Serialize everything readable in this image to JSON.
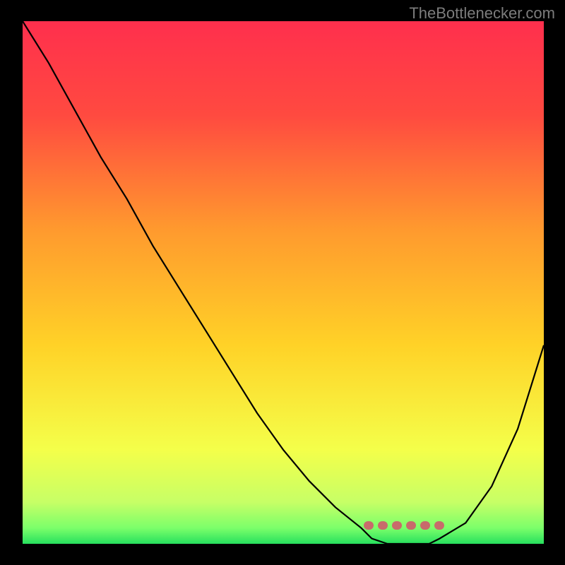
{
  "source_label": "TheBottlenecker.com",
  "colors": {
    "gradient_top": "#ff2f4d",
    "gradient_mid": "#ffd227",
    "gradient_low": "#eaff6f",
    "gradient_bottom": "#27e05e",
    "curve": "#000000",
    "dash": "#c86b6b",
    "bg": "#000000"
  },
  "chart_data": {
    "type": "line",
    "title": "",
    "xlabel": "",
    "ylabel": "",
    "xlim": [
      0,
      100
    ],
    "ylim": [
      0,
      100
    ],
    "x": [
      0,
      5,
      10,
      15,
      20,
      25,
      30,
      35,
      40,
      45,
      50,
      55,
      60,
      65,
      67,
      70,
      73,
      75,
      78,
      80,
      85,
      90,
      95,
      100
    ],
    "values": [
      100,
      92,
      83,
      74,
      66,
      57,
      49,
      41,
      33,
      25,
      18,
      12,
      7,
      3,
      1,
      0,
      0,
      0,
      0,
      1,
      4,
      11,
      22,
      38
    ],
    "optimal_band": {
      "start": 67,
      "end": 80,
      "value": 0
    }
  }
}
